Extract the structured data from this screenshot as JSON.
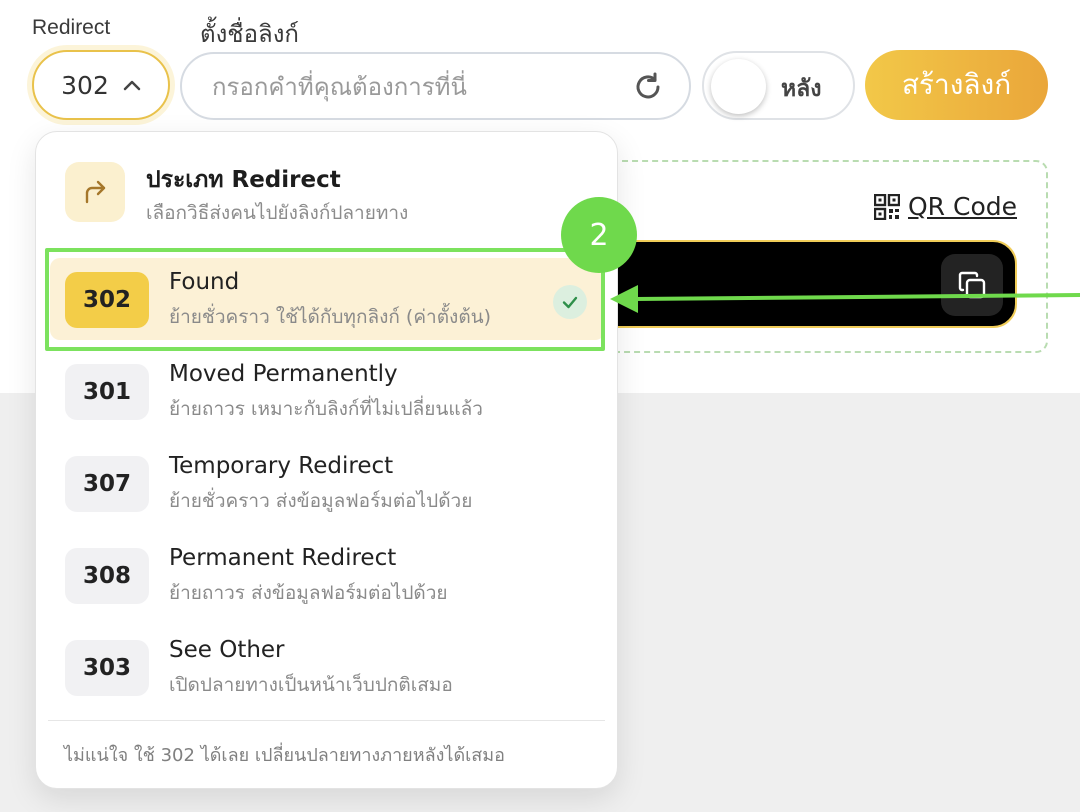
{
  "form": {
    "redirect_label": "Redirect",
    "name_label": "ตั้งชื่อลิงก์",
    "redirect_value": "302",
    "name_placeholder": "กรอกคำที่คุณต้องการที่นี่",
    "toggle_label": "หลัง",
    "create_button": "สร้างลิงก์"
  },
  "result": {
    "qr_label": "QR Code"
  },
  "dropdown": {
    "title": "ประเภท Redirect",
    "subtitle": "เลือกวิธีส่งคนไปยังลิงก์ปลายทาง",
    "options": [
      {
        "code": "302",
        "title": "Found",
        "desc": "ย้ายชั่วคราว ใช้ได้กับทุกลิงก์ (ค่าตั้งต้น)",
        "selected": true
      },
      {
        "code": "301",
        "title": "Moved Permanently",
        "desc": "ย้ายถาวร เหมาะกับลิงก์ที่ไม่เปลี่ยนแล้ว",
        "selected": false
      },
      {
        "code": "307",
        "title": "Temporary Redirect",
        "desc": "ย้ายชั่วคราว ส่งข้อมูลฟอร์มต่อไปด้วย",
        "selected": false
      },
      {
        "code": "308",
        "title": "Permanent Redirect",
        "desc": "ย้ายถาวร ส่งข้อมูลฟอร์มต่อไปด้วย",
        "selected": false
      },
      {
        "code": "303",
        "title": "See Other",
        "desc": "เปิดปลายทางเป็นหน้าเว็บปกติเสมอ",
        "selected": false
      }
    ],
    "footer": "ไม่แน่ใจ ใช้ 302 ได้เลย เปลี่ยนปลายทางภายหลังได้เสมอ"
  },
  "annotation": {
    "step": "2",
    "color": "#6fd94c"
  }
}
